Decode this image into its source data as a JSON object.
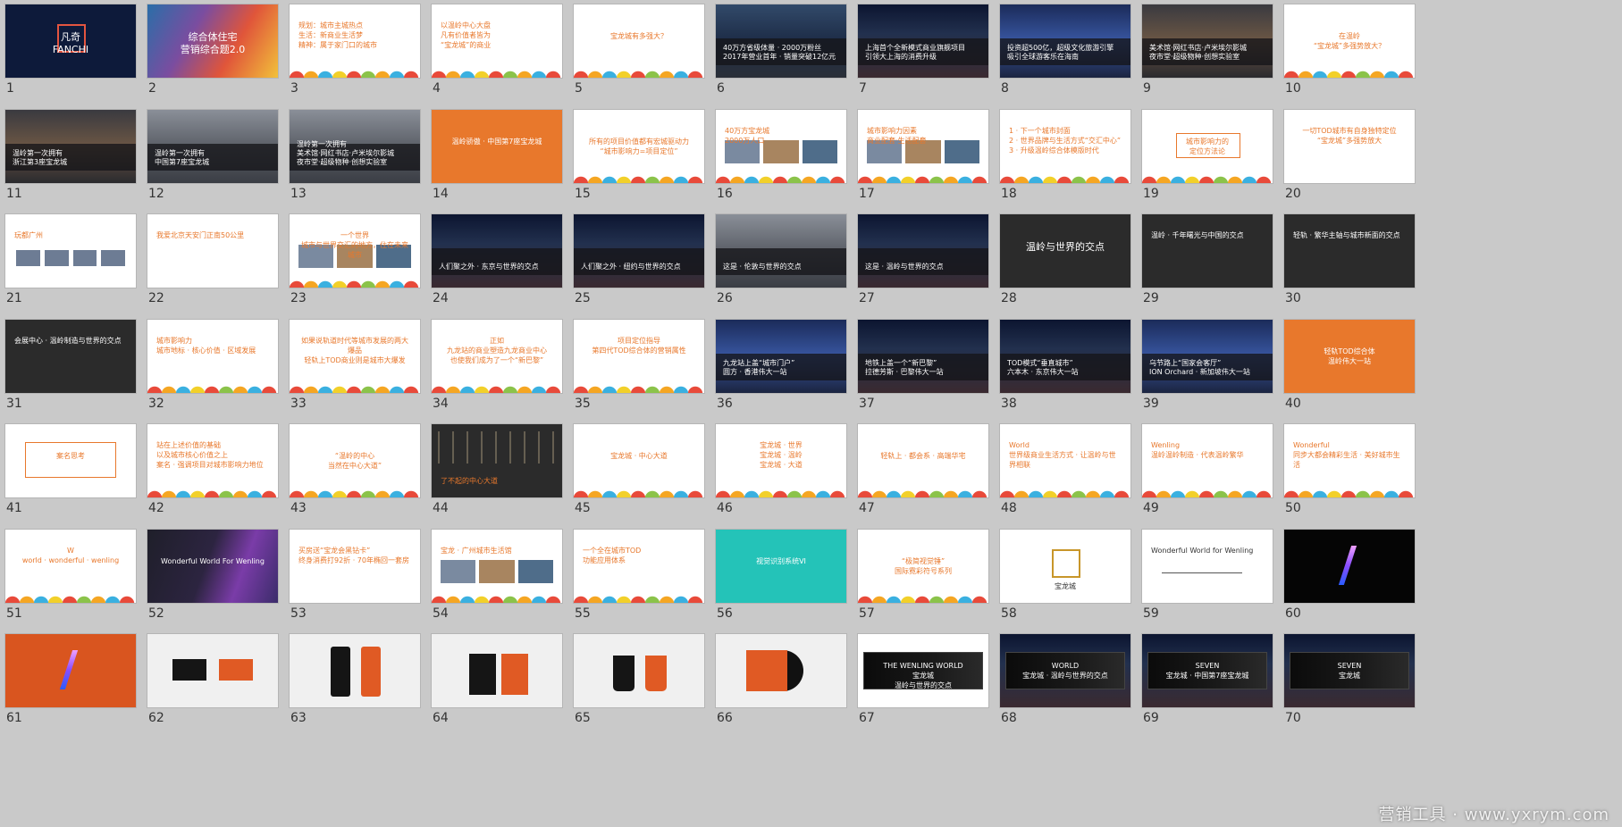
{
  "slides": [
    {
      "n": "1",
      "theme": "navy",
      "deco": "logo",
      "text": "凡奇\nFANCHI",
      "align": "center",
      "color": "white",
      "size": "big"
    },
    {
      "n": "2",
      "theme": "gradient",
      "deco": "",
      "text": "综合体住宅\n营销综合题2.0",
      "align": "center",
      "color": "white",
      "size": "big"
    },
    {
      "n": "3",
      "theme": "white",
      "deco": "arcs",
      "text": "规划：城市主城热点\n生活：新商业生活梦\n精神：属于家门口的城市",
      "align": "left",
      "color": "orange",
      "size": ""
    },
    {
      "n": "4",
      "theme": "white",
      "deco": "arcs",
      "text": "以温岭中心大盘\n凡有价值者皆为\n“宝龙城”的商业",
      "align": "left",
      "color": "orange",
      "size": ""
    },
    {
      "n": "5",
      "theme": "white",
      "deco": "arcs",
      "text": "宝龙城有多强大？",
      "align": "center",
      "color": "orange",
      "size": "mid"
    },
    {
      "n": "6",
      "theme": "photo-city",
      "deco": "banner",
      "text": "40万方省级体量 · 2000万粉丝\n2017年营业首年 · 销量突破12亿元",
      "align": "left",
      "color": "white",
      "size": "banner"
    },
    {
      "n": "7",
      "theme": "photo-night",
      "deco": "banner",
      "text": "上海首个全新模式商业旗舰项目\n引领大上海的消费升级",
      "align": "left",
      "color": "white",
      "size": "banner"
    },
    {
      "n": "8",
      "theme": "photo-blue",
      "deco": "banner",
      "text": "投资超500亿，超级文化旅游引擎\n吸引全球游客乐在海南",
      "align": "left",
      "color": "white",
      "size": "banner"
    },
    {
      "n": "9",
      "theme": "photo-warm",
      "deco": "banner",
      "text": "美术馆·网红书店·卢米埃尔影城\n夜市堂·超级物种·创想实验室",
      "align": "left",
      "color": "white",
      "size": "banner"
    },
    {
      "n": "10",
      "theme": "white",
      "deco": "arcs",
      "text": "在温岭\n“宝龙城”多强势放大？",
      "align": "center",
      "color": "orange",
      "size": "mid"
    },
    {
      "n": "11",
      "theme": "photo-warm",
      "deco": "banner",
      "text": "温岭第一次拥有\n浙江第3座宝龙城",
      "align": "left",
      "color": "white",
      "size": "banner"
    },
    {
      "n": "12",
      "theme": "photo-gray",
      "deco": "banner",
      "text": "温岭第一次拥有\n中国第7座宝龙城",
      "align": "left",
      "color": "white",
      "size": "banner"
    },
    {
      "n": "13",
      "theme": "photo-gray",
      "deco": "banner",
      "text": "温岭第一次拥有\n美术馆·网红书店·卢米埃尔影城\n夜市堂·超级物种·创想实验室",
      "align": "left",
      "color": "white",
      "size": "banner"
    },
    {
      "n": "14",
      "theme": "orange",
      "deco": "",
      "text": "温岭骄傲 · 中国第7座宝龙城",
      "align": "center",
      "color": "white",
      "size": "mid"
    },
    {
      "n": "15",
      "theme": "white",
      "deco": "arcs",
      "text": "所有的项目价值都有宏城驱动力\n“城市影响力=项目定位”",
      "align": "center",
      "color": "orange",
      "size": "mid"
    },
    {
      "n": "16",
      "theme": "white",
      "deco": "imgs",
      "text": "40万方宝龙城\n2000万人口",
      "align": "left",
      "color": "orange",
      "size": ""
    },
    {
      "n": "17",
      "theme": "white",
      "deco": "imgs",
      "text": "城市影响力因素\n商业配套·生活配套",
      "align": "left",
      "color": "orange",
      "size": ""
    },
    {
      "n": "18",
      "theme": "white",
      "deco": "arcs",
      "text": "1 · 下一个城市封面\n2 · 世界品牌与生活方式“交汇中心”\n3 · 升级温岭综合体模版时代",
      "align": "left",
      "color": "orange",
      "size": ""
    },
    {
      "n": "19",
      "theme": "white",
      "deco": "tag",
      "text": "城市影响力的\n定位方法论",
      "align": "center",
      "color": "orange",
      "size": "mid"
    },
    {
      "n": "20",
      "theme": "white",
      "deco": "",
      "text": "一切TOD城市有自身独特定位\n“宝龙城”多强势放大",
      "align": "center",
      "color": "orange",
      "size": ""
    },
    {
      "n": "21",
      "theme": "white",
      "deco": "chips",
      "text": "玩都广州",
      "align": "left",
      "color": "orange",
      "size": ""
    },
    {
      "n": "22",
      "theme": "white",
      "deco": "",
      "text": "我爱北京天安门正南50公里",
      "align": "left",
      "color": "orange",
      "size": ""
    },
    {
      "n": "23",
      "theme": "white",
      "deco": "imgs",
      "text": "一个世界\n城市与世界交汇的地方，住在未来城市",
      "align": "center",
      "color": "orange",
      "size": ""
    },
    {
      "n": "24",
      "theme": "photo-night",
      "deco": "banner",
      "text": "人们聚之外 · 东京与世界的交点",
      "align": "left",
      "color": "white",
      "size": "banner"
    },
    {
      "n": "25",
      "theme": "photo-night",
      "deco": "banner",
      "text": "人们聚之外 · 纽约与世界的交点",
      "align": "left",
      "color": "white",
      "size": "banner"
    },
    {
      "n": "26",
      "theme": "photo-gray",
      "deco": "banner",
      "text": "这是 · 伦敦与世界的交点",
      "align": "left",
      "color": "white",
      "size": "banner"
    },
    {
      "n": "27",
      "theme": "photo-night",
      "deco": "banner",
      "text": "这是 · 温岭与世界的交点",
      "align": "left",
      "color": "white",
      "size": "banner"
    },
    {
      "n": "28",
      "theme": "dark",
      "deco": "",
      "text": "温岭与世界的交点",
      "align": "center",
      "color": "white",
      "size": "big"
    },
    {
      "n": "29",
      "theme": "dark",
      "deco": "",
      "text": "温岭 · 千年曙光与中国的交点",
      "align": "left",
      "color": "white",
      "size": ""
    },
    {
      "n": "30",
      "theme": "dark",
      "deco": "",
      "text": "轻轨 · 繁华主轴与城市新面的交点",
      "align": "left",
      "color": "white",
      "size": ""
    },
    {
      "n": "31",
      "theme": "dark",
      "deco": "",
      "text": "会展中心 · 温岭制造与世界的交点",
      "align": "left",
      "color": "white",
      "size": ""
    },
    {
      "n": "32",
      "theme": "white",
      "deco": "arcs",
      "text": "城市影响力\n城市地标 · 核心价值 · 区域发展",
      "align": "left",
      "color": "orange",
      "size": ""
    },
    {
      "n": "33",
      "theme": "white",
      "deco": "arcs",
      "text": "如果说轨道时代等城市发展的两大爆品\n轻轨上TOD商业则是城市大爆发",
      "align": "center",
      "color": "orange",
      "size": ""
    },
    {
      "n": "34",
      "theme": "white",
      "deco": "arcs",
      "text": "正如\n九龙站的商业塑造九龙商业中心\n也使我们成为了一个“新巴黎”",
      "align": "center",
      "color": "orange",
      "size": ""
    },
    {
      "n": "35",
      "theme": "white",
      "deco": "arcs",
      "text": "项目定位指导\n第四代TOD综合体的营销属性",
      "align": "center",
      "color": "orange",
      "size": ""
    },
    {
      "n": "36",
      "theme": "photo-blue",
      "deco": "banner",
      "text": "九龙站上盖“城市门户”\n圆方 · 香港伟大一站",
      "align": "left",
      "color": "white",
      "size": "banner"
    },
    {
      "n": "37",
      "theme": "photo-night",
      "deco": "banner",
      "text": "地铁上盖一个“新巴黎”\n拉德芳斯 · 巴黎伟大一站",
      "align": "left",
      "color": "white",
      "size": "banner"
    },
    {
      "n": "38",
      "theme": "photo-night",
      "deco": "banner",
      "text": "TOD模式“垂直城市”\n六本木 · 东京伟大一站",
      "align": "left",
      "color": "white",
      "size": "banner"
    },
    {
      "n": "39",
      "theme": "photo-blue",
      "deco": "banner",
      "text": "乌节路上“国家会客厅”\nION Orchard · 新加坡伟大一站",
      "align": "left",
      "color": "white",
      "size": "banner"
    },
    {
      "n": "40",
      "theme": "orange",
      "deco": "",
      "text": "轻轨TOD综合体\n温岭伟大一站",
      "align": "center",
      "color": "white",
      "size": "mid"
    },
    {
      "n": "41",
      "theme": "white",
      "deco": "box",
      "text": "案名思考",
      "align": "center",
      "color": "orange",
      "size": "mid"
    },
    {
      "n": "42",
      "theme": "white",
      "deco": "arcs",
      "text": "站在上述价值的基础\n以及城市核心价值之上\n案名 · 强调项目对城市影响力地位",
      "align": "left",
      "color": "orange",
      "size": ""
    },
    {
      "n": "43",
      "theme": "white",
      "deco": "arcs",
      "text": "“温岭的中心\n当然在中心大道”",
      "align": "center",
      "color": "orange",
      "size": "mid"
    },
    {
      "n": "44",
      "theme": "dark",
      "deco": "streaks",
      "text": "了不起的中心大道",
      "align": "left",
      "color": "orange",
      "size": "low"
    },
    {
      "n": "45",
      "theme": "white",
      "deco": "arcs",
      "text": "宝龙城 · 中心大道",
      "align": "center",
      "color": "orange",
      "size": "mid"
    },
    {
      "n": "46",
      "theme": "white",
      "deco": "arcs",
      "text": "宝龙城 · 世界\n宝龙城 · 温岭\n宝龙城 · 大道",
      "align": "center",
      "color": "orange",
      "size": ""
    },
    {
      "n": "47",
      "theme": "white",
      "deco": "arcs",
      "text": "轻轨上 · 都会系 · 高端华宅",
      "align": "center",
      "color": "orange",
      "size": "mid"
    },
    {
      "n": "48",
      "theme": "white",
      "deco": "arcs",
      "text": "World\n世界级商业生活方式 · 让温岭与世界相联",
      "align": "left",
      "color": "orange",
      "size": ""
    },
    {
      "n": "49",
      "theme": "white",
      "deco": "arcs",
      "text": "Wenling\n温岭温岭制造 · 代表温岭繁华",
      "align": "left",
      "color": "orange",
      "size": ""
    },
    {
      "n": "50",
      "theme": "white",
      "deco": "arcs",
      "text": "Wonderful\n同步大都会精彩生活 · 美好城市生活",
      "align": "left",
      "color": "orange",
      "size": ""
    },
    {
      "n": "51",
      "theme": "white",
      "deco": "arcs",
      "text": "W\nworld · wonderful · wenling",
      "align": "center",
      "color": "orange",
      "size": ""
    },
    {
      "n": "52",
      "theme": "purple",
      "deco": "",
      "text": "Wonderful World For Wenling",
      "align": "center",
      "color": "white",
      "size": "mid"
    },
    {
      "n": "53",
      "theme": "white",
      "deco": "",
      "text": "买房送“宝龙会黑钻卡”\n终身消费打92折 · 70年椭回一套房",
      "align": "left",
      "color": "orange",
      "size": ""
    },
    {
      "n": "54",
      "theme": "white",
      "deco": "imgs",
      "text": "宝龙 · 广州城市生活馆",
      "align": "left",
      "color": "orange",
      "size": ""
    },
    {
      "n": "55",
      "theme": "white",
      "deco": "arcs",
      "text": "一个全在城市TOD\n功能应用体系",
      "align": "left",
      "color": "orange",
      "size": ""
    },
    {
      "n": "56",
      "theme": "teal",
      "deco": "",
      "text": "视觉识别系统VI",
      "align": "center",
      "color": "white",
      "size": "mid"
    },
    {
      "n": "57",
      "theme": "white",
      "deco": "arcs",
      "text": "“极简视觉锤”\n国际霓彩符号系列",
      "align": "center",
      "color": "orange",
      "size": "mid"
    },
    {
      "n": "58",
      "theme": "white",
      "deco": "logo2",
      "text": "宝龙城",
      "align": "center",
      "color": "dark",
      "size": "low"
    },
    {
      "n": "59",
      "theme": "white",
      "deco": "line",
      "text": "Wonderful World for Wenling",
      "align": "left",
      "color": "dark",
      "size": ""
    },
    {
      "n": "60",
      "theme": "black",
      "deco": "slash",
      "text": "",
      "align": "center",
      "color": "white",
      "size": ""
    },
    {
      "n": "61",
      "theme": "orangebg",
      "deco": "slash",
      "text": "",
      "align": "center",
      "color": "white",
      "size": ""
    },
    {
      "n": "62",
      "theme": "lightgray",
      "deco": "cards",
      "text": "",
      "align": "center",
      "color": "dark",
      "size": ""
    },
    {
      "n": "63",
      "theme": "lightgray",
      "deco": "phones",
      "text": "",
      "align": "center",
      "color": "dark",
      "size": ""
    },
    {
      "n": "64",
      "theme": "lightgray",
      "deco": "bags",
      "text": "",
      "align": "center",
      "color": "dark",
      "size": ""
    },
    {
      "n": "65",
      "theme": "lightgray",
      "deco": "cups",
      "text": "",
      "align": "center",
      "color": "dark",
      "size": ""
    },
    {
      "n": "66",
      "theme": "lightgray",
      "deco": "disc",
      "text": "",
      "align": "center",
      "color": "dark",
      "size": ""
    },
    {
      "n": "67",
      "theme": "white",
      "deco": "billboard",
      "text": "THE WENLING WORLD\n宝龙城\n温岭与世界的交点",
      "align": "center",
      "color": "white",
      "size": "mid"
    },
    {
      "n": "68",
      "theme": "photo-night",
      "deco": "billboard",
      "text": "WORLD\n宝龙城 · 温岭与世界的交点",
      "align": "center",
      "color": "white",
      "size": "mid"
    },
    {
      "n": "69",
      "theme": "photo-night",
      "deco": "billboard",
      "text": "SEVEN\n宝龙城 · 中国第7座宝龙城",
      "align": "center",
      "color": "white",
      "size": "mid"
    },
    {
      "n": "70",
      "theme": "photo-night",
      "deco": "billboard",
      "text": "SEVEN\n宝龙城",
      "align": "center",
      "color": "white",
      "size": "mid"
    }
  ],
  "watermark": "营销工具 · www.yxrym.com"
}
